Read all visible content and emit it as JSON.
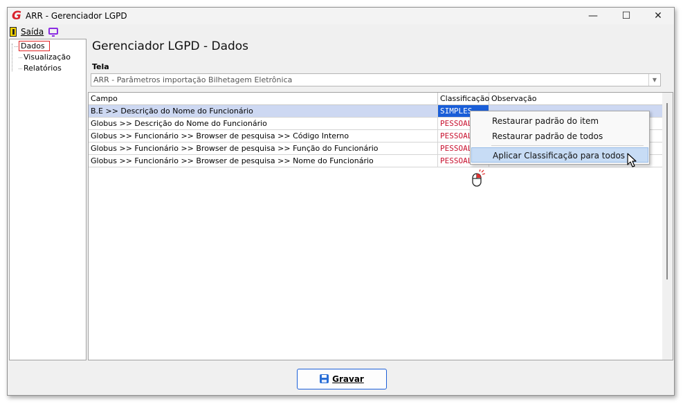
{
  "window": {
    "title": "ARR - Gerenciador LGPD",
    "app_icon": "g-logo-icon",
    "controls": {
      "minimize": "—",
      "maximize": "☐",
      "close": "✕"
    }
  },
  "menu": {
    "exit_label": "Saída",
    "exit_icon": "exit-door-icon",
    "monitor_icon": "monitor-icon"
  },
  "tree": {
    "items": [
      {
        "label": "Dados",
        "selected": true
      },
      {
        "label": "Visualização",
        "selected": false
      },
      {
        "label": "Relatórios",
        "selected": false
      }
    ]
  },
  "main": {
    "title": "Gerenciador LGPD - Dados",
    "screen_label": "Tela",
    "screen_value": "ARR - Parâmetros importação Bilhetagem Eletrônica"
  },
  "grid": {
    "columns": [
      "Campo",
      "Classificação",
      "Observação"
    ],
    "rows": [
      {
        "campo": "B.E >> Descrição do Nome do Funcionário",
        "classificacao": "SIMPLES",
        "observacao": ""
      },
      {
        "campo": "Globus >> Descrição do Nome do Funcionário",
        "classificacao": "PESSOAL",
        "observacao": ""
      },
      {
        "campo": "Globus >> Funcionário >> Browser de pesquisa >> Código Interno",
        "classificacao": "PESSOAL",
        "observacao": ""
      },
      {
        "campo": "Globus >> Funcionário >> Browser de pesquisa >> Função do Funcionário",
        "classificacao": "PESSOAL",
        "observacao": ""
      },
      {
        "campo": "Globus >> Funcionário >> Browser de pesquisa >> Nome do Funcionário",
        "classificacao": "PESSOAL",
        "observacao": ""
      }
    ]
  },
  "context_menu": {
    "items": [
      "Restaurar padrão do item",
      "Restaurar padrão de todos",
      "Aplicar Classificação para todos"
    ]
  },
  "footer": {
    "save_label": "Gravar",
    "save_icon": "floppy-disk-icon"
  },
  "colors": {
    "pessoal": "#c8102e",
    "simples_bg": "#1a5ed8",
    "selection": "#cdd8f2",
    "logo": "#d9232d"
  }
}
